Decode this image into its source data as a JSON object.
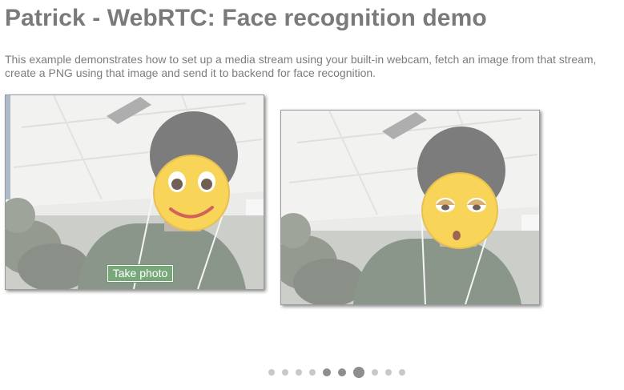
{
  "header": {
    "title": "Patrick - WebRTC: Face recognition demo"
  },
  "intro": {
    "text": "This example demonstrates how to set up a media stream using your built-in webcam, fetch an image from that stream, create a PNG using that image and send it to backend for face recognition."
  },
  "video": {
    "overlay": "smiling-emoji"
  },
  "camera": {
    "take_photo_label": "Take photo"
  },
  "result": {
    "overlay": "eye-roll-emoji"
  },
  "pagination": {
    "total": 10,
    "active_index": 6
  },
  "colors": {
    "title": "#7a7a7a",
    "text": "#7d7d7d",
    "button": "#78a87a",
    "emoji": "#f5c518"
  }
}
